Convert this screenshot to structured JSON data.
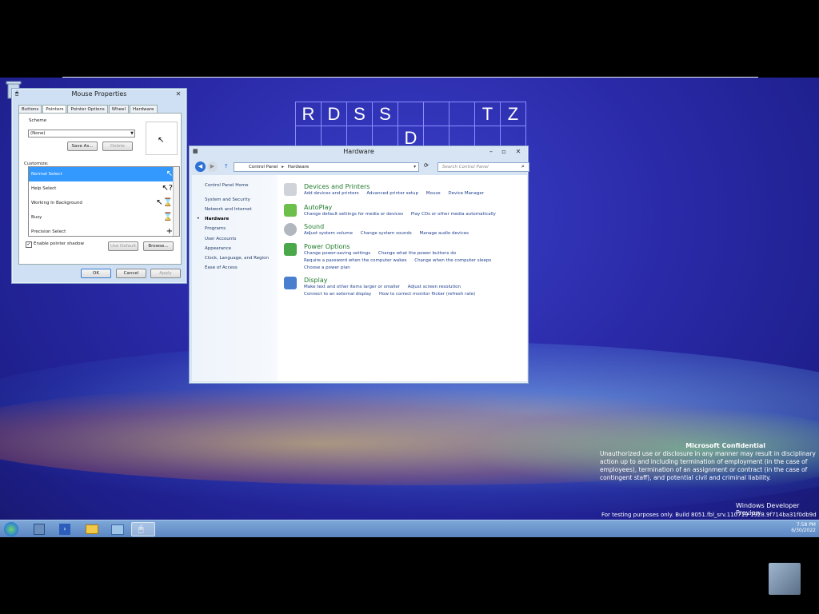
{
  "desktop": {
    "letters_row1": [
      "R",
      "D",
      "S",
      "S",
      "",
      "",
      "",
      "T",
      "Z"
    ],
    "letters_row2": [
      "",
      "",
      "",
      "",
      "D",
      "",
      "",
      "",
      ""
    ],
    "watermark": {
      "title": "Microsoft Confidential",
      "body": "Unauthorized use or disclosure in any manner may result in disciplinary action up to and including termination of employment (in the case of employees), termination of an assignment or contract (in the case of contingent staff), and potential civil and criminal liability.",
      "edition": "Windows Developer Preview",
      "build": "For testing purposes only. Build 8051.fbl_srv.110719-1928.9f714ba31f0db9d"
    }
  },
  "mouse_properties": {
    "title": "Mouse Properties",
    "tabs": [
      "Buttons",
      "Pointers",
      "Pointer Options",
      "Wheel",
      "Hardware"
    ],
    "scheme_label": "Scheme",
    "scheme_value": "(None)",
    "save_as": "Save As...",
    "delete": "Delete",
    "customize_label": "Customize:",
    "cursors": [
      {
        "label": "Normal Select",
        "glyph": "↖"
      },
      {
        "label": "Help Select",
        "glyph": "↖?"
      },
      {
        "label": "Working In Background",
        "glyph": "↖⌛"
      },
      {
        "label": "Busy",
        "glyph": "⌛"
      },
      {
        "label": "Precision Select",
        "glyph": "+"
      }
    ],
    "enable_shadow": "Enable pointer shadow",
    "use_default": "Use Default",
    "browse": "Browse...",
    "ok": "OK",
    "cancel": "Cancel",
    "apply": "Apply"
  },
  "hardware": {
    "title": "Hardware",
    "address": [
      "Control Panel",
      "Hardware"
    ],
    "search_placeholder": "Search Control Panel",
    "left_nav": [
      "Control Panel Home",
      "System and Security",
      "Network and Internet",
      "Hardware",
      "Programs",
      "User Accounts",
      "Appearance",
      "Clock, Language, and Region",
      "Ease of Access"
    ],
    "categories": [
      {
        "title": "Devices and Printers",
        "links": [
          [
            "Add devices and printers",
            "Advanced printer setup",
            "Mouse",
            "Device Manager"
          ]
        ]
      },
      {
        "title": "AutoPlay",
        "links": [
          [
            "Change default settings for media or devices",
            "Play CDs or other media automatically"
          ]
        ]
      },
      {
        "title": "Sound",
        "links": [
          [
            "Adjust system volume",
            "Change system sounds",
            "Manage audio devices"
          ]
        ]
      },
      {
        "title": "Power Options",
        "links": [
          [
            "Change power-saving settings",
            "Change what the power buttons do"
          ],
          [
            "Require a password when the computer wakes",
            "Change when the computer sleeps"
          ],
          [
            "Choose a power plan"
          ]
        ]
      },
      {
        "title": "Display",
        "links": [
          [
            "Make text and other items larger or smaller",
            "Adjust screen resolution"
          ],
          [
            "Connect to an external display",
            "How to correct monitor flicker (refresh rate)"
          ]
        ]
      }
    ]
  },
  "taskbar": {
    "time": "7:58 PM",
    "date": "6/30/2022"
  }
}
